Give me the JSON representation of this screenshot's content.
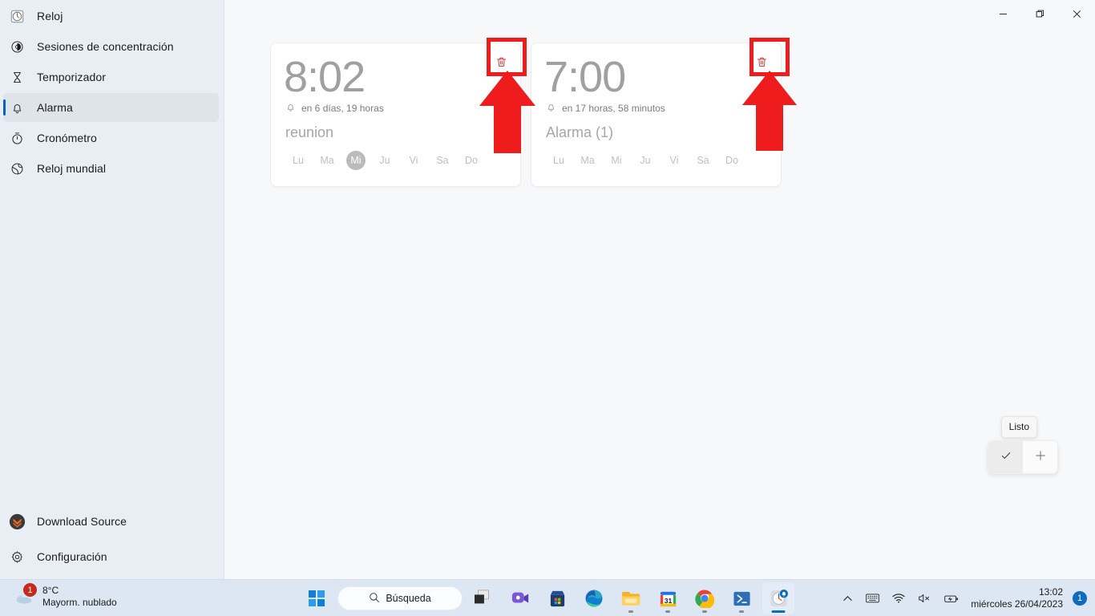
{
  "app": {
    "title": "Reloj",
    "window_controls": {
      "minimize": "–",
      "maximize": "❐",
      "close": "✕"
    }
  },
  "sidebar": {
    "items": [
      {
        "label": "Reloj",
        "icon": "clock-icon",
        "selected": false
      },
      {
        "label": "Sesiones de concentración",
        "icon": "focus-icon",
        "selected": false
      },
      {
        "label": "Temporizador",
        "icon": "hourglass-icon",
        "selected": false
      },
      {
        "label": "Alarma",
        "icon": "bell-icon",
        "selected": true
      },
      {
        "label": "Cronómetro",
        "icon": "stopwatch-icon",
        "selected": false
      },
      {
        "label": "Reloj mundial",
        "icon": "globe-icon",
        "selected": false
      }
    ],
    "bottom_items": [
      {
        "label": "Download Source",
        "icon": "download-source-icon"
      },
      {
        "label": "Configuración",
        "icon": "gear-icon"
      }
    ]
  },
  "alarms": [
    {
      "time": "8:02",
      "remaining": "en 6 días, 19 horas",
      "name": "reunion",
      "days": [
        {
          "label": "Lu",
          "active": false
        },
        {
          "label": "Ma",
          "active": false
        },
        {
          "label": "Mi",
          "active": true
        },
        {
          "label": "Ju",
          "active": false
        },
        {
          "label": "Vi",
          "active": false
        },
        {
          "label": "Sa",
          "active": false
        },
        {
          "label": "Do",
          "active": false
        }
      ],
      "delete_label": "Eliminar"
    },
    {
      "time": "7:00",
      "remaining": "en 17 horas, 58 minutos",
      "name": "Alarma (1)",
      "days": [
        {
          "label": "Lu",
          "active": false
        },
        {
          "label": "Ma",
          "active": false
        },
        {
          "label": "Mi",
          "active": false
        },
        {
          "label": "Ju",
          "active": false
        },
        {
          "label": "Vi",
          "active": false
        },
        {
          "label": "Sa",
          "active": false
        },
        {
          "label": "Do",
          "active": false
        }
      ],
      "delete_label": "Eliminar"
    }
  ],
  "fab": {
    "tooltip": "Listo",
    "done_icon": "check-icon",
    "add_icon": "plus-icon"
  },
  "annotation": {
    "color": "#ee1c1c",
    "boxes": 2,
    "arrows": 2
  },
  "taskbar": {
    "weather": {
      "temperature": "8°C",
      "condition": "Mayorm. nublado",
      "badge": "1"
    },
    "search": {
      "placeholder": "Búsqueda",
      "icon": "search-icon"
    },
    "apps": [
      {
        "name": "start-button",
        "icon": "windows-logo-icon"
      },
      {
        "name": "task-view",
        "icon": "task-view-icon"
      },
      {
        "name": "microsoft-teams",
        "icon": "teams-icon"
      },
      {
        "name": "microsoft-store",
        "icon": "store-icon"
      },
      {
        "name": "microsoft-edge",
        "icon": "edge-icon"
      },
      {
        "name": "file-explorer",
        "icon": "folder-icon"
      },
      {
        "name": "calendar",
        "icon": "calendar-icon",
        "day": "31"
      },
      {
        "name": "google-chrome",
        "icon": "chrome-icon"
      },
      {
        "name": "powershell",
        "icon": "powershell-icon"
      },
      {
        "name": "clock-app",
        "icon": "clock-app-icon",
        "active": true,
        "badge": "bell"
      }
    ],
    "tray": {
      "chevron": "show-hidden-icons",
      "keyboard": "keyboard-icon",
      "wifi": "wifi-icon",
      "volume": "volume-muted-icon",
      "battery": "battery-charging-icon",
      "time": "13:02",
      "date": "miércoles 26/04/2023",
      "notifications": "1"
    }
  }
}
